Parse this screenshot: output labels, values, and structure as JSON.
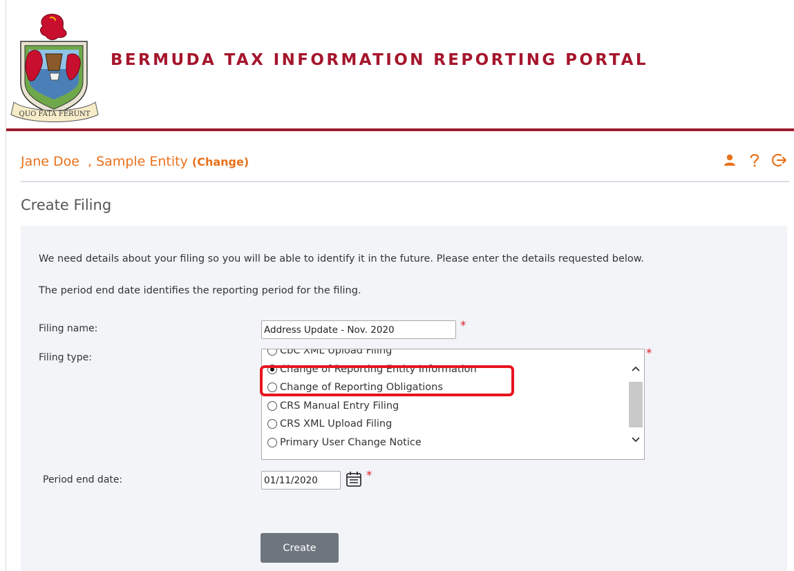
{
  "header": {
    "portal_title": "BERMUDA TAX INFORMATION REPORTING PORTAL",
    "crest_motto": "QUO FATA FERUNT",
    "icons": [
      "crest-logo"
    ]
  },
  "user_bar": {
    "user_name": "Jane Doe",
    "entity_name": "Sample Entity",
    "separator": ",",
    "change_link": "(Change)",
    "icons": [
      "user-icon",
      "help-icon",
      "logout-icon"
    ],
    "accent_color": "#e8711b"
  },
  "page": {
    "title": "Create Filing"
  },
  "form": {
    "intro_line1": "We need details about your filing so you will be able to identify it in the future. Please enter the details requested below.",
    "intro_line2": "The period end date identifies the reporting period for the filing.",
    "filing_name_label": "Filing name:",
    "filing_name_value": "Address Update - Nov. 2020",
    "filing_type_label": "Filing type:",
    "filing_type_options": [
      {
        "label": "CbC XML Upload Filing",
        "selected": false
      },
      {
        "label": "Change of Reporting Entity Information",
        "selected": true
      },
      {
        "label": "Change of Reporting Obligations",
        "selected": false
      },
      {
        "label": "CRS Manual Entry Filing",
        "selected": false
      },
      {
        "label": "CRS XML Upload Filing",
        "selected": false
      },
      {
        "label": "Primary User Change Notice",
        "selected": false
      }
    ],
    "period_end_label": "Period end date:",
    "period_end_value": "01/11/2020",
    "required_marker": "*",
    "create_button": "Create"
  },
  "colors": {
    "brand_red": "#a5152c",
    "required_red": "#d81f26",
    "highlight_red": "#e8141e",
    "panel_bg": "#f2f4f8",
    "button_gray": "#6d767e"
  }
}
